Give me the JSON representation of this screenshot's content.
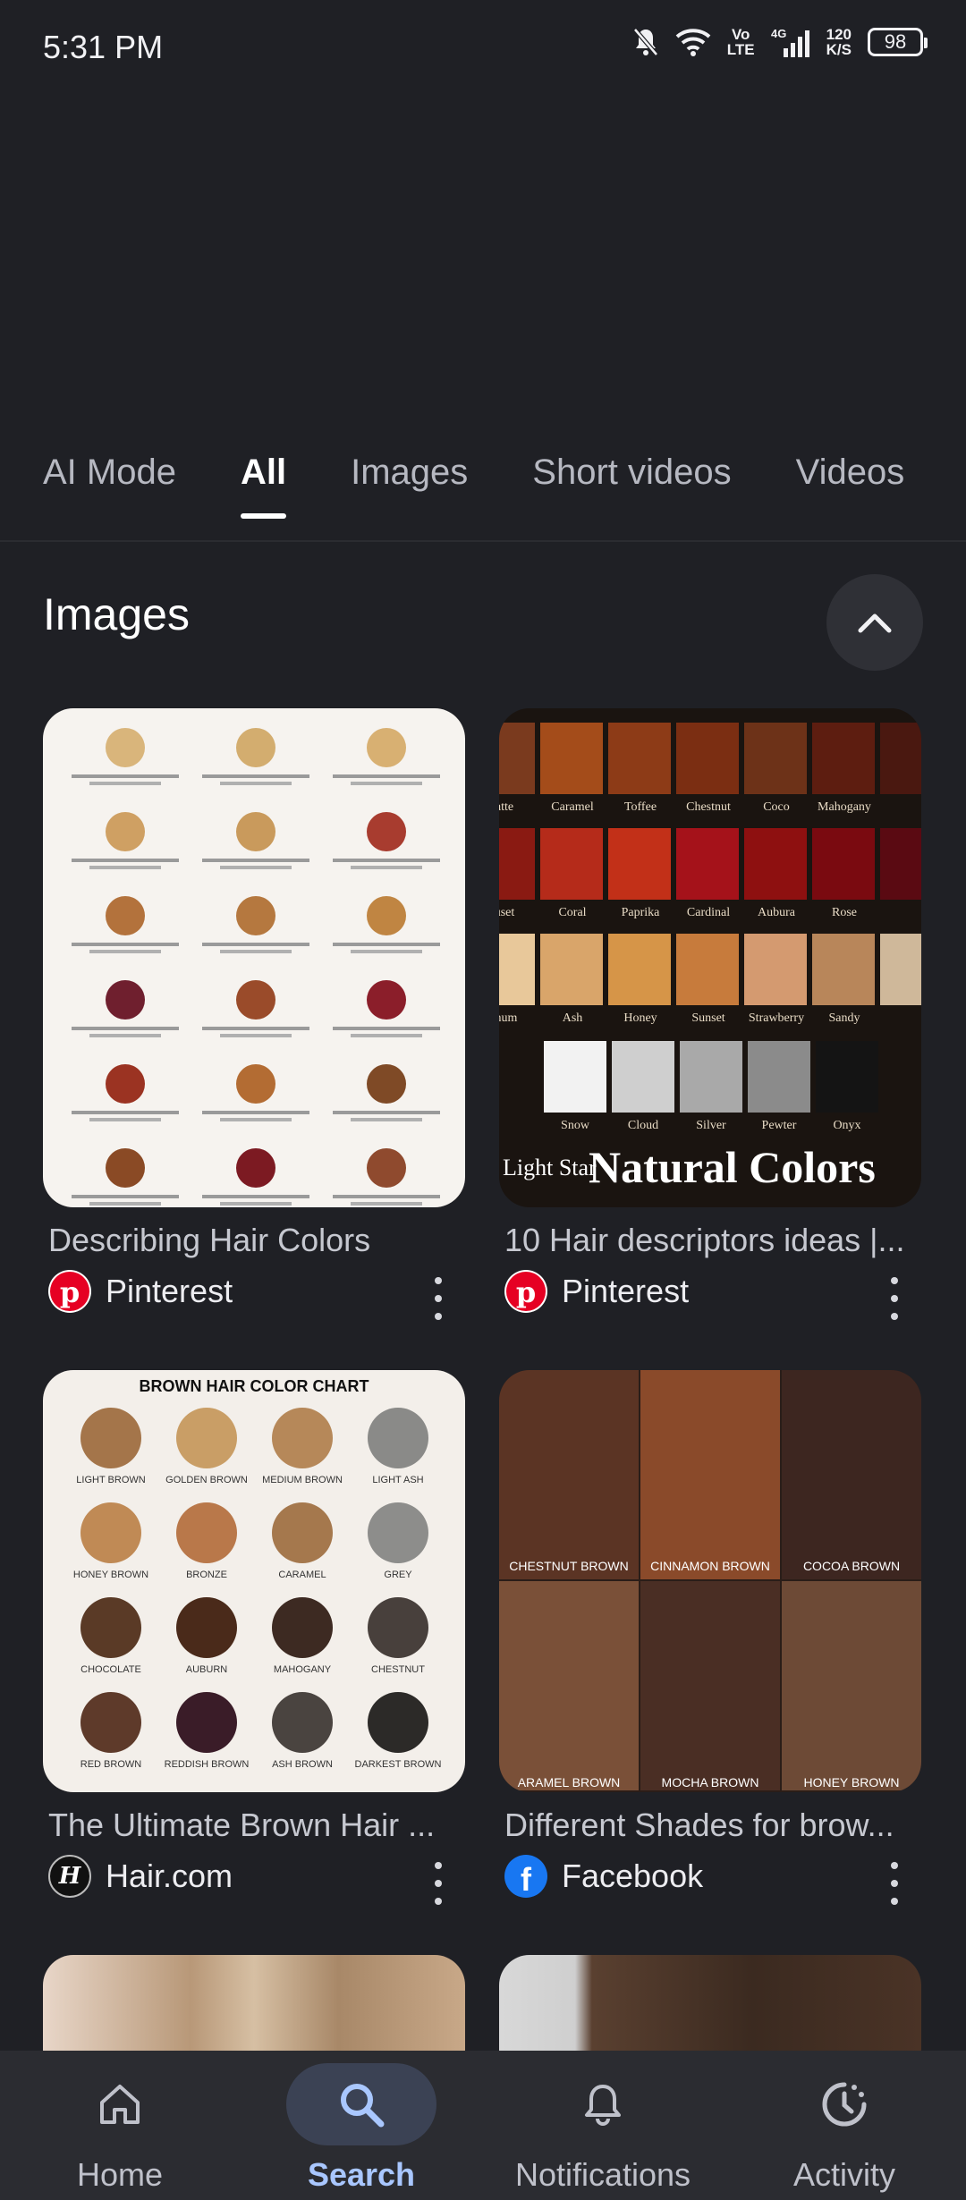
{
  "status": {
    "time": "5:31 PM",
    "volte": "Vo\nLTE",
    "network": "4G",
    "speed_value": "120",
    "speed_unit": "K/S",
    "battery": "98"
  },
  "tabs": [
    {
      "label": "AI Mode",
      "active": false
    },
    {
      "label": "All",
      "active": true
    },
    {
      "label": "Images",
      "active": false
    },
    {
      "label": "Short videos",
      "active": false
    },
    {
      "label": "Videos",
      "active": false
    }
  ],
  "images_section": {
    "title": "Images",
    "results": [
      {
        "caption": "Describing Hair Colors",
        "source": "Pinterest",
        "source_icon": "pinterest-icon",
        "brand_color": "#e60023"
      },
      {
        "caption": "10 Hair descriptors ideas |...",
        "source": "Pinterest",
        "source_icon": "pinterest-icon",
        "brand_color": "#e60023",
        "image_text": {
          "row1": [
            "atte",
            "Caramel",
            "Toffee",
            "Chestnut",
            "Coco",
            "Mahogany"
          ],
          "row2": [
            "uset",
            "Coral",
            "Paprika",
            "Cardinal",
            "Aubura",
            "Rose"
          ],
          "row3": [
            "inum",
            "Ash",
            "Honey",
            "Sunset",
            "Strawberry",
            "Sandy"
          ],
          "row4": [
            "Snow",
            "Cloud",
            "Silver",
            "Pewter",
            "Onyx"
          ],
          "brand": "Light Star",
          "banner": "Natural Colors"
        }
      },
      {
        "caption": "The Ultimate Brown Hair ...",
        "source": "Hair.com",
        "source_icon": "hair-com-icon",
        "brand_color": "#111111",
        "image_text": {
          "title": "BROWN HAIR COLOR CHART",
          "labels": [
            "LIGHT BROWN",
            "GOLDEN BROWN",
            "MEDIUM BROWN",
            "LIGHT ASH",
            "HONEY BROWN",
            "BRONZE",
            "CARAMEL",
            "GREY",
            "CHOCOLATE",
            "AUBURN",
            "MAHOGANY",
            "CHESTNUT",
            "RED BROWN",
            "REDDISH BROWN",
            "ASH BROWN",
            "DARKEST BROWN"
          ]
        }
      },
      {
        "caption": "Different Shades for brow...",
        "source": "Facebook",
        "source_icon": "facebook-icon",
        "brand_color": "#1877f2",
        "image_text": {
          "top": [
            "CHESTNUT BROWN",
            "CINNAMON BROWN",
            "COCOA BROWN"
          ],
          "bottom": [
            "ARAMEL BROWN",
            "MOCHA BROWN",
            "HONEY BROWN"
          ]
        }
      }
    ]
  },
  "bottom_nav": [
    {
      "label": "Home",
      "icon": "home-icon",
      "active": false
    },
    {
      "label": "Search",
      "icon": "search-icon",
      "active": true
    },
    {
      "label": "Notifications",
      "icon": "bell-icon",
      "active": false
    },
    {
      "label": "Activity",
      "icon": "activity-icon",
      "active": false
    }
  ]
}
